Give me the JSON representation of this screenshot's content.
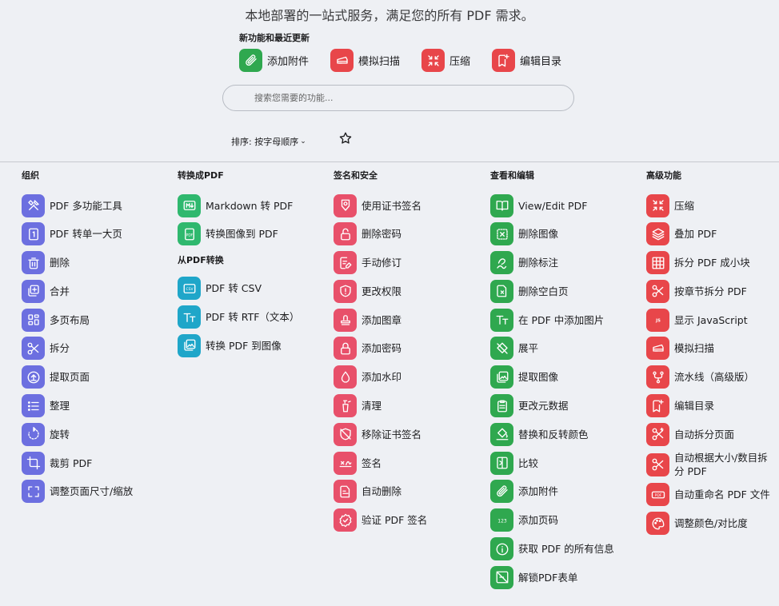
{
  "tagline": "本地部署的一站式服务，满足您的所有 PDF 需求。",
  "new_features": {
    "title": "新功能和最近更新",
    "items": [
      {
        "label": "添加附件",
        "icon": "paperclip-icon",
        "color": "#2fa84f"
      },
      {
        "label": "模拟扫描",
        "icon": "scanner-icon",
        "color": "#e8464a"
      },
      {
        "label": "压缩",
        "icon": "compress-icon",
        "color": "#e8464a"
      },
      {
        "label": "编辑目录",
        "icon": "bookmark-icon",
        "color": "#e8464a"
      }
    ]
  },
  "search": {
    "placeholder": "搜索您需要的功能..."
  },
  "sort": {
    "label": "排序: 按字母顺序"
  },
  "colors": {
    "organize": "#6c6fe0",
    "convert": "#2fb86e",
    "convert_from": "#1fa6c9",
    "security": "#e8506a",
    "edit": "#2fa84f",
    "advanced": "#e8464a"
  },
  "columns": {
    "organize": {
      "title": "组织",
      "items": [
        {
          "label": "PDF 多功能工具",
          "icon": "tools-icon"
        },
        {
          "label": "PDF 转单一大页",
          "icon": "single-page-icon"
        },
        {
          "label": "删除",
          "icon": "trash-icon"
        },
        {
          "label": "合并",
          "icon": "merge-icon"
        },
        {
          "label": "多页布局",
          "icon": "grid-layout-icon"
        },
        {
          "label": "拆分",
          "icon": "scissors-icon"
        },
        {
          "label": "提取页面",
          "icon": "upload-icon"
        },
        {
          "label": "整理",
          "icon": "list-icon"
        },
        {
          "label": "旋转",
          "icon": "rotate-icon"
        },
        {
          "label": "裁剪 PDF",
          "icon": "crop-icon"
        },
        {
          "label": "调整页面尺寸/缩放",
          "icon": "fullscreen-icon"
        }
      ]
    },
    "convert_to": {
      "title": "转换成PDF",
      "items": [
        {
          "label": "Markdown 转 PDF",
          "icon": "markdown-icon"
        },
        {
          "label": "转换图像到 PDF",
          "icon": "image-to-pdf-icon"
        }
      ]
    },
    "convert_from": {
      "title": "从PDF转换",
      "items": [
        {
          "label": "PDF 转 CSV",
          "icon": "csv-icon"
        },
        {
          "label": "PDF 转 RTF（文本）",
          "icon": "text-format-icon"
        },
        {
          "label": "转换 PDF 到图像",
          "icon": "image-icon"
        }
      ]
    },
    "security": {
      "title": "签名和安全",
      "items": [
        {
          "label": "使用证书签名",
          "icon": "certificate-icon"
        },
        {
          "label": "删除密码",
          "icon": "unlock-icon"
        },
        {
          "label": "手动修订",
          "icon": "edit-doc-icon"
        },
        {
          "label": "更改权限",
          "icon": "shield-icon"
        },
        {
          "label": "添加图章",
          "icon": "stamp-icon"
        },
        {
          "label": "添加密码",
          "icon": "lock-icon"
        },
        {
          "label": "添加水印",
          "icon": "water-drop-icon"
        },
        {
          "label": "清理",
          "icon": "sanitize-icon"
        },
        {
          "label": "移除证书签名",
          "icon": "shield-off-icon"
        },
        {
          "label": "签名",
          "icon": "signature-icon"
        },
        {
          "label": "自动删除",
          "icon": "auto-redact-icon"
        },
        {
          "label": "验证 PDF 签名",
          "icon": "verified-icon"
        }
      ]
    },
    "edit": {
      "title": "查看和编辑",
      "items": [
        {
          "label": "View/Edit PDF",
          "icon": "book-icon"
        },
        {
          "label": "删除图像",
          "icon": "remove-image-icon"
        },
        {
          "label": "删除标注",
          "icon": "remove-annotation-icon"
        },
        {
          "label": "删除空白页",
          "icon": "blank-page-icon"
        },
        {
          "label": "在 PDF 中添加图片",
          "icon": "add-text-icon"
        },
        {
          "label": "展平",
          "icon": "flatten-icon"
        },
        {
          "label": "提取图像",
          "icon": "extract-image-icon"
        },
        {
          "label": "更改元数据",
          "icon": "clipboard-icon"
        },
        {
          "label": "替换和反转颜色",
          "icon": "paint-bucket-icon"
        },
        {
          "label": "比较",
          "icon": "compare-icon"
        },
        {
          "label": "添加附件",
          "icon": "paperclip-icon"
        },
        {
          "label": "添加页码",
          "icon": "page-number-icon"
        },
        {
          "label": "获取 PDF 的所有信息",
          "icon": "info-icon"
        },
        {
          "label": "解锁PDF表单",
          "icon": "unlock-form-icon"
        }
      ]
    },
    "advanced": {
      "title": "高级功能",
      "items": [
        {
          "label": "压缩",
          "icon": "compress-icon"
        },
        {
          "label": "叠加 PDF",
          "icon": "layers-icon"
        },
        {
          "label": "拆分 PDF 成小块",
          "icon": "table-grid-icon"
        },
        {
          "label": "按章节拆分 PDF",
          "icon": "scissors-icon"
        },
        {
          "label": "显示 JavaScript",
          "icon": "javascript-icon"
        },
        {
          "label": "模拟扫描",
          "icon": "scanner-icon"
        },
        {
          "label": "流水线（高级版）",
          "icon": "pipeline-icon"
        },
        {
          "label": "编辑目录",
          "icon": "bookmark-icon"
        },
        {
          "label": "自动拆分页面",
          "icon": "auto-split-icon"
        },
        {
          "label": "自动根据大小/数目拆分 PDF",
          "icon": "split-size-icon"
        },
        {
          "label": "自动重命名 PDF 文件",
          "icon": "rename-icon"
        },
        {
          "label": "调整颜色/对比度",
          "icon": "palette-icon"
        }
      ]
    }
  }
}
